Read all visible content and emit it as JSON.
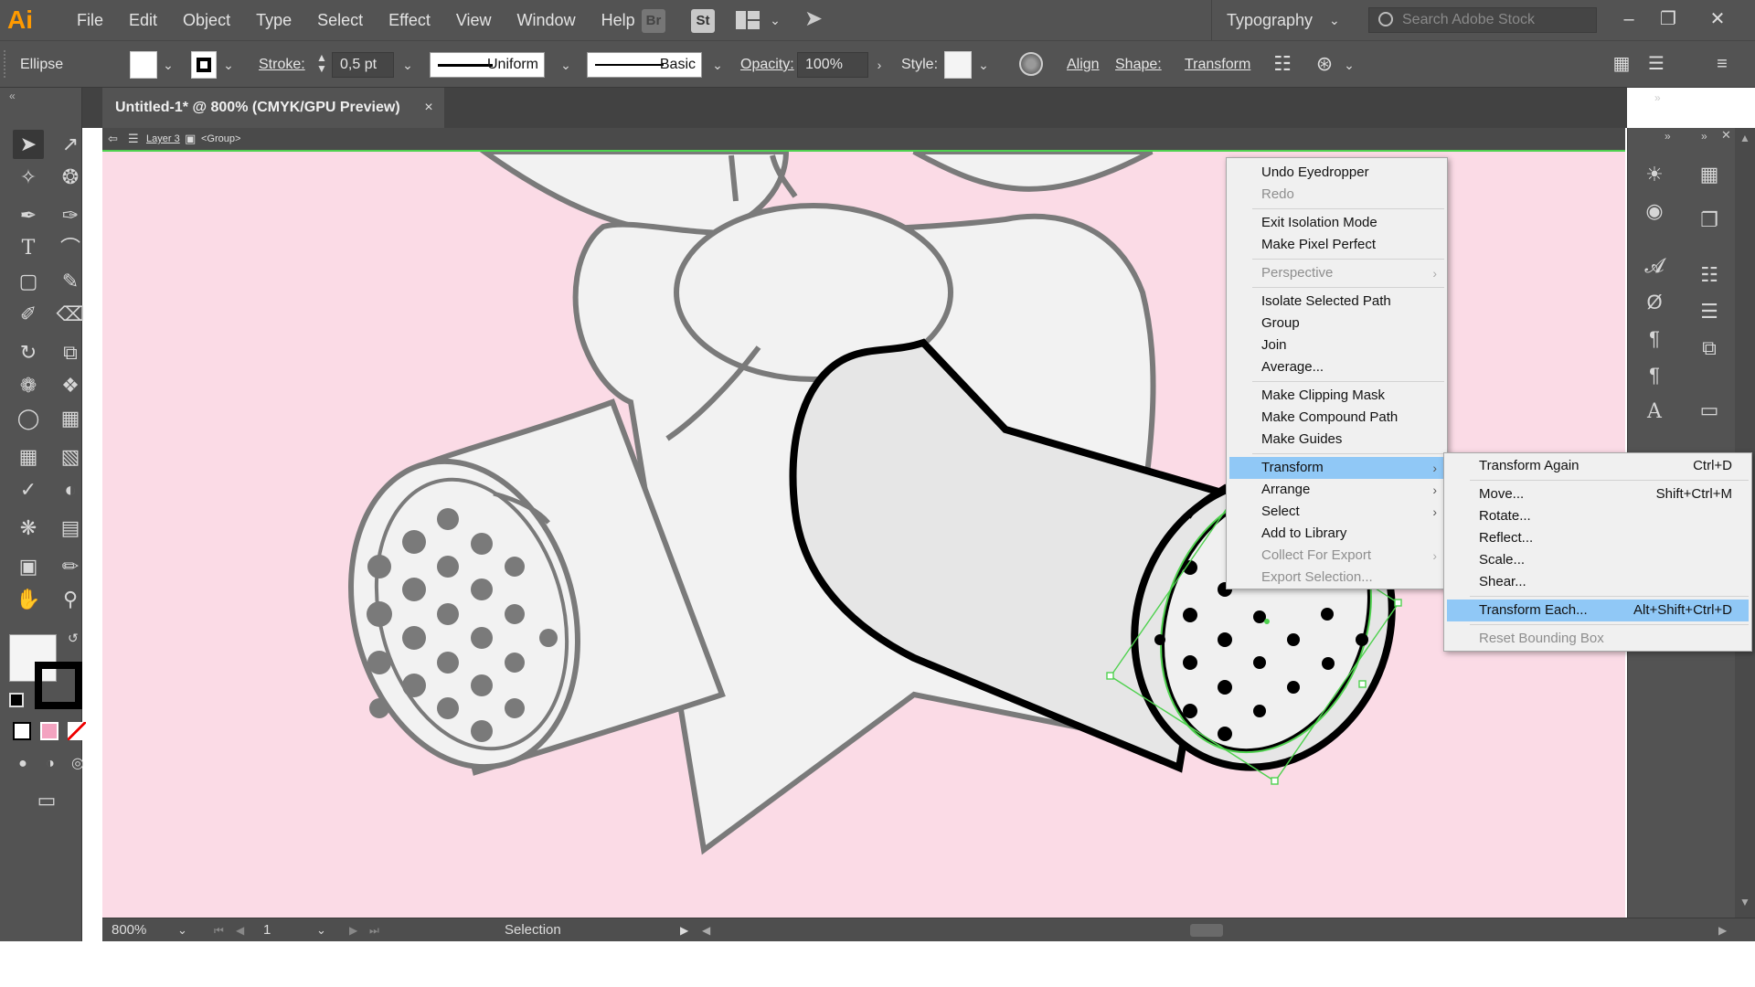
{
  "app": {
    "logo": "Ai",
    "menu": [
      "File",
      "Edit",
      "Object",
      "Type",
      "Select",
      "Effect",
      "View",
      "Window",
      "Help"
    ],
    "bridge_icon": "Br",
    "stock_icon": "St",
    "workspace": "Typography",
    "search_placeholder": "Search Adobe Stock"
  },
  "control_bar": {
    "object_type": "Ellipse",
    "stroke_label": "Stroke:",
    "stroke_weight": "0,5 pt",
    "profile": "Uniform",
    "brush": "Basic",
    "opacity_label": "Opacity:",
    "opacity_value": "100%",
    "style_label": "Style:",
    "align_label": "Align",
    "shape_label": "Shape:",
    "transform_label": "Transform"
  },
  "document": {
    "tab_title": "Untitled-1* @ 800% (CMYK/GPU Preview)",
    "close": "×",
    "breadcrumb_layer": "Layer 3",
    "breadcrumb_group": "<Group>"
  },
  "status": {
    "zoom": "800%",
    "artboard": "1",
    "tool": "Selection"
  },
  "context_menu": {
    "items": [
      {
        "label": "Undo Eyedropper",
        "enabled": true
      },
      {
        "label": "Redo",
        "enabled": false
      },
      {
        "label": "Exit Isolation Mode",
        "enabled": true
      },
      {
        "label": "Make Pixel Perfect",
        "enabled": true
      },
      {
        "label": "Perspective",
        "enabled": false,
        "submenu": true
      },
      {
        "label": "Isolate Selected Path",
        "enabled": true
      },
      {
        "label": "Group",
        "enabled": true
      },
      {
        "label": "Join",
        "enabled": true
      },
      {
        "label": "Average...",
        "enabled": true
      },
      {
        "label": "Make Clipping Mask",
        "enabled": true
      },
      {
        "label": "Make Compound Path",
        "enabled": true
      },
      {
        "label": "Make Guides",
        "enabled": true
      },
      {
        "label": "Transform",
        "enabled": true,
        "submenu": true,
        "highlighted": true
      },
      {
        "label": "Arrange",
        "enabled": true,
        "submenu": true
      },
      {
        "label": "Select",
        "enabled": true,
        "submenu": true
      },
      {
        "label": "Add to Library",
        "enabled": true
      },
      {
        "label": "Collect For Export",
        "enabled": false,
        "submenu": true
      },
      {
        "label": "Export Selection...",
        "enabled": false
      }
    ]
  },
  "transform_submenu": {
    "items": [
      {
        "label": "Transform Again",
        "shortcut": "Ctrl+D",
        "enabled": true
      },
      {
        "label": "Move...",
        "shortcut": "Shift+Ctrl+M",
        "enabled": true
      },
      {
        "label": "Rotate...",
        "shortcut": "",
        "enabled": true
      },
      {
        "label": "Reflect...",
        "shortcut": "",
        "enabled": true
      },
      {
        "label": "Scale...",
        "shortcut": "",
        "enabled": true
      },
      {
        "label": "Shear...",
        "shortcut": "",
        "enabled": true
      },
      {
        "label": "Transform Each...",
        "shortcut": "Alt+Shift+Ctrl+D",
        "enabled": true,
        "highlighted": true
      },
      {
        "label": "Reset Bounding Box",
        "shortcut": "",
        "enabled": false
      }
    ]
  },
  "colors": {
    "ui_dark": "#535353",
    "canvas_bg": "#fbdbe6",
    "selection": "#4fd14f",
    "menu_highlight": "#90c8f6",
    "logo": "#ff9a00"
  }
}
